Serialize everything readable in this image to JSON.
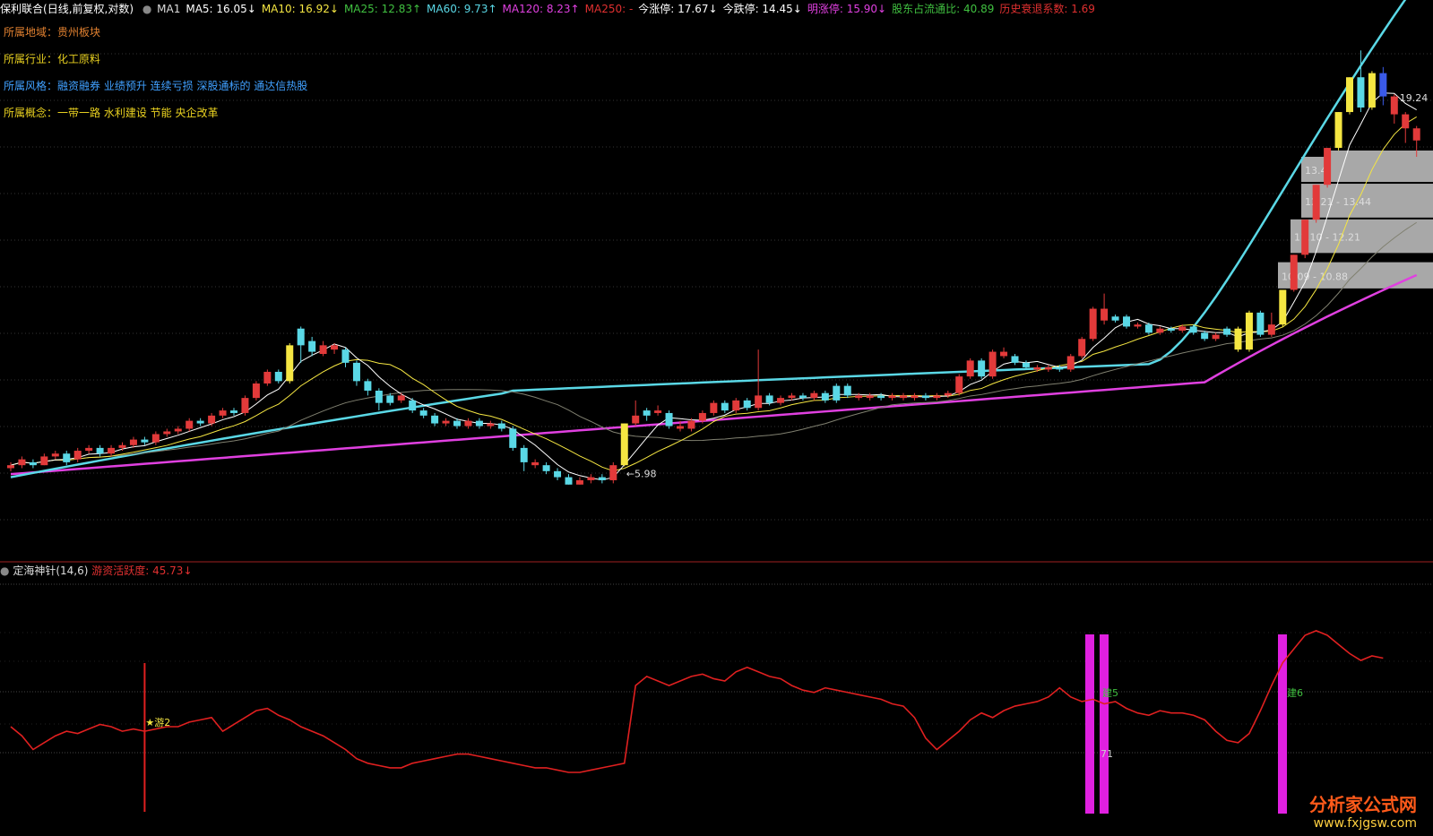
{
  "header": {
    "title": "保利联合",
    "mode": "(日线,前复权,对数)",
    "ma_items": [
      {
        "label": "MA1",
        "color": "#dddddd"
      },
      {
        "label": "MA5: 16.05↓",
        "color": "#ffffff"
      },
      {
        "label": "MA10: 16.92↓",
        "color": "#f5e642"
      },
      {
        "label": "MA25: 12.83↑",
        "color": "#40c040"
      },
      {
        "label": "MA60: 9.73↑",
        "color": "#5ad8e6"
      },
      {
        "label": "MA120: 8.23↑",
        "color": "#e040e0"
      },
      {
        "label": "MA250: -",
        "color": "#e03030"
      },
      {
        "label": "今涨停: 17.67↓",
        "color": "#ffffff"
      },
      {
        "label": "今跌停: 14.45↓",
        "color": "#ffffff"
      },
      {
        "label": "明涨停: 15.90↓",
        "color": "#e040e0"
      },
      {
        "label": "股东占流通比: 40.89",
        "color": "#40c040"
      },
      {
        "label": "历史衰退系数: 1.69",
        "color": "#e03030"
      }
    ]
  },
  "info": {
    "region_label": "所属地域：",
    "region_value": "贵州板块",
    "industry_label": "所属行业：",
    "industry_value": "化工原料",
    "style_label": "所属风格：",
    "style_value": "融资融券 业绩预升 连续亏损 深股通标的 通达信热股",
    "concept_label": "所属概念：",
    "concept_value": "一带一路 水利建设 节能 央企改革"
  },
  "sub_header": {
    "indicator": "定海神针(14,6)",
    "value": "游资活跃度: 45.73↓"
  },
  "watermark": {
    "name": "分析家公式网",
    "url": "www.fxjgsw.com"
  },
  "chart_data": [
    {
      "type": "candlestick",
      "title": "保利联合",
      "y_scale": "log",
      "ylim": [
        5.0,
        21.0
      ],
      "annotations": [
        {
          "text": "←5.98",
          "index": 55
        },
        {
          "text": "19.24",
          "index": 124
        }
      ],
      "volume_profile": [
        {
          "label": "13.44 - 14.45",
          "low": 13.44,
          "high": 14.45
        },
        {
          "label": "12.21 - 13.44",
          "low": 12.21,
          "high": 13.44
        },
        {
          "label": "11.10 - 12.21",
          "low": 11.1,
          "high": 12.21
        },
        {
          "label": "10.09 - 10.88",
          "low": 10.09,
          "high": 10.88
        }
      ],
      "candles": [
        [
          6.25,
          6.3,
          6.2,
          6.35,
          "up"
        ],
        [
          6.3,
          6.4,
          6.25,
          6.45,
          "up"
        ],
        [
          6.35,
          6.3,
          6.25,
          6.4,
          "down"
        ],
        [
          6.3,
          6.45,
          6.3,
          6.5,
          "up"
        ],
        [
          6.45,
          6.5,
          6.4,
          6.55,
          "up"
        ],
        [
          6.5,
          6.35,
          6.3,
          6.55,
          "down"
        ],
        [
          6.4,
          6.55,
          6.35,
          6.6,
          "up"
        ],
        [
          6.55,
          6.6,
          6.5,
          6.65,
          "up"
        ],
        [
          6.6,
          6.5,
          6.45,
          6.65,
          "down"
        ],
        [
          6.5,
          6.6,
          6.45,
          6.65,
          "up"
        ],
        [
          6.6,
          6.65,
          6.55,
          6.7,
          "up"
        ],
        [
          6.65,
          6.75,
          6.6,
          6.8,
          "up"
        ],
        [
          6.75,
          6.7,
          6.65,
          6.8,
          "down"
        ],
        [
          6.7,
          6.85,
          6.65,
          6.9,
          "up"
        ],
        [
          6.85,
          6.9,
          6.8,
          6.95,
          "up"
        ],
        [
          6.9,
          6.95,
          6.85,
          7.0,
          "up"
        ],
        [
          6.95,
          7.1,
          6.9,
          7.15,
          "up"
        ],
        [
          7.1,
          7.05,
          7.0,
          7.15,
          "down"
        ],
        [
          7.05,
          7.2,
          7.0,
          7.25,
          "up"
        ],
        [
          7.2,
          7.3,
          7.15,
          7.35,
          "up"
        ],
        [
          7.3,
          7.25,
          7.2,
          7.35,
          "down"
        ],
        [
          7.25,
          7.55,
          7.2,
          7.6,
          "up"
        ],
        [
          7.55,
          7.85,
          7.5,
          7.9,
          "up"
        ],
        [
          7.85,
          8.1,
          7.8,
          8.15,
          "up"
        ],
        [
          8.1,
          7.9,
          7.85,
          8.15,
          "down"
        ],
        [
          7.9,
          8.7,
          7.85,
          8.75,
          "limit"
        ],
        [
          8.7,
          9.1,
          8.3,
          9.15,
          "down"
        ],
        [
          8.8,
          8.55,
          8.45,
          8.9,
          "down"
        ],
        [
          8.5,
          8.7,
          8.45,
          8.8,
          "up"
        ],
        [
          8.7,
          8.6,
          8.5,
          8.75,
          "up"
        ],
        [
          8.6,
          8.3,
          8.2,
          8.65,
          "down"
        ],
        [
          8.3,
          7.9,
          7.8,
          8.35,
          "down"
        ],
        [
          7.9,
          7.7,
          7.6,
          7.95,
          "down"
        ],
        [
          7.7,
          7.45,
          7.3,
          7.75,
          "down"
        ],
        [
          7.45,
          7.6,
          7.4,
          7.65,
          "down"
        ],
        [
          7.6,
          7.5,
          7.45,
          7.65,
          "up"
        ],
        [
          7.5,
          7.3,
          7.25,
          7.55,
          "down"
        ],
        [
          7.3,
          7.2,
          7.15,
          7.35,
          "down"
        ],
        [
          7.2,
          7.05,
          7.0,
          7.25,
          "down"
        ],
        [
          7.05,
          7.1,
          7.0,
          7.15,
          "up"
        ],
        [
          7.1,
          7.0,
          6.95,
          7.15,
          "down"
        ],
        [
          7.0,
          7.1,
          6.95,
          7.15,
          "up"
        ],
        [
          7.1,
          7.0,
          6.95,
          7.15,
          "down"
        ],
        [
          7.0,
          7.05,
          6.95,
          7.1,
          "up"
        ],
        [
          7.05,
          6.95,
          6.9,
          7.1,
          "down"
        ],
        [
          6.95,
          6.6,
          6.55,
          7.0,
          "down"
        ],
        [
          6.6,
          6.35,
          6.2,
          6.65,
          "down"
        ],
        [
          6.35,
          6.3,
          6.25,
          6.4,
          "up"
        ],
        [
          6.3,
          6.2,
          6.15,
          6.35,
          "down"
        ],
        [
          6.2,
          6.1,
          6.05,
          6.25,
          "down"
        ],
        [
          6.1,
          5.98,
          5.98,
          6.15,
          "down"
        ],
        [
          5.98,
          6.05,
          5.98,
          6.1,
          "up"
        ],
        [
          6.05,
          6.1,
          6.0,
          6.15,
          "up"
        ],
        [
          6.1,
          6.05,
          6.0,
          6.15,
          "down"
        ],
        [
          6.05,
          6.3,
          6.0,
          6.35,
          "up"
        ],
        [
          6.3,
          7.05,
          6.28,
          7.05,
          "limit"
        ],
        [
          7.05,
          7.2,
          7.0,
          7.5,
          "up"
        ],
        [
          7.2,
          7.3,
          7.1,
          7.35,
          "down"
        ],
        [
          7.3,
          7.25,
          7.2,
          7.4,
          "up"
        ],
        [
          7.25,
          7.0,
          6.95,
          7.3,
          "down"
        ],
        [
          7.0,
          6.95,
          6.9,
          7.1,
          "up"
        ],
        [
          6.95,
          7.1,
          6.9,
          7.15,
          "up"
        ],
        [
          7.1,
          7.25,
          7.05,
          7.3,
          "up"
        ],
        [
          7.25,
          7.45,
          7.2,
          7.5,
          "up"
        ],
        [
          7.45,
          7.3,
          7.25,
          7.5,
          "down"
        ],
        [
          7.3,
          7.5,
          7.25,
          7.55,
          "up"
        ],
        [
          7.5,
          7.35,
          7.3,
          7.55,
          "down"
        ],
        [
          7.35,
          7.6,
          7.3,
          8.6,
          "up"
        ],
        [
          7.6,
          7.45,
          7.4,
          7.65,
          "down"
        ],
        [
          7.45,
          7.55,
          7.4,
          7.6,
          "up"
        ],
        [
          7.55,
          7.6,
          7.5,
          7.65,
          "up"
        ],
        [
          7.6,
          7.55,
          7.5,
          7.65,
          "down"
        ],
        [
          7.55,
          7.65,
          7.5,
          7.7,
          "up"
        ],
        [
          7.65,
          7.5,
          7.45,
          7.7,
          "down"
        ],
        [
          7.5,
          7.8,
          7.45,
          7.85,
          "down"
        ],
        [
          7.8,
          7.6,
          7.55,
          7.85,
          "down"
        ],
        [
          7.6,
          7.55,
          7.5,
          7.65,
          "up"
        ],
        [
          7.55,
          7.6,
          7.5,
          7.65,
          "up"
        ],
        [
          7.6,
          7.55,
          7.5,
          7.65,
          "down"
        ],
        [
          7.55,
          7.6,
          7.5,
          7.65,
          "up"
        ],
        [
          7.6,
          7.55,
          7.5,
          7.65,
          "up"
        ],
        [
          7.55,
          7.6,
          7.5,
          7.65,
          "up"
        ],
        [
          7.6,
          7.55,
          7.5,
          7.65,
          "down"
        ],
        [
          7.55,
          7.6,
          7.5,
          7.65,
          "up"
        ],
        [
          7.6,
          7.65,
          7.55,
          7.7,
          "up"
        ],
        [
          7.65,
          8.0,
          7.6,
          8.05,
          "up"
        ],
        [
          8.0,
          8.35,
          7.95,
          8.4,
          "up"
        ],
        [
          8.35,
          8.0,
          7.95,
          8.4,
          "down"
        ],
        [
          8.0,
          8.55,
          7.95,
          8.6,
          "up"
        ],
        [
          8.55,
          8.45,
          8.4,
          8.65,
          "up"
        ],
        [
          8.45,
          8.3,
          8.25,
          8.5,
          "down"
        ],
        [
          8.3,
          8.2,
          8.15,
          8.35,
          "down"
        ],
        [
          8.2,
          8.15,
          8.1,
          8.25,
          "up"
        ],
        [
          8.15,
          8.2,
          8.1,
          8.25,
          "up"
        ],
        [
          8.2,
          8.15,
          8.1,
          8.25,
          "down"
        ],
        [
          8.15,
          8.45,
          8.1,
          8.5,
          "up"
        ],
        [
          8.45,
          8.85,
          8.4,
          8.9,
          "up"
        ],
        [
          8.85,
          9.6,
          8.8,
          9.65,
          "up"
        ],
        [
          9.6,
          9.3,
          9.2,
          10.0,
          "up"
        ],
        [
          9.3,
          9.4,
          9.25,
          9.45,
          "down"
        ],
        [
          9.4,
          9.15,
          9.1,
          9.45,
          "down"
        ],
        [
          9.15,
          9.2,
          9.1,
          9.25,
          "up"
        ],
        [
          9.2,
          9.0,
          8.95,
          9.25,
          "down"
        ],
        [
          9.0,
          9.1,
          8.95,
          9.15,
          "up"
        ],
        [
          9.1,
          9.05,
          9.0,
          9.15,
          "down"
        ],
        [
          9.05,
          9.15,
          9.0,
          9.2,
          "up"
        ],
        [
          9.15,
          9.0,
          8.95,
          9.2,
          "down"
        ],
        [
          9.0,
          8.85,
          8.8,
          9.05,
          "down"
        ],
        [
          8.85,
          8.95,
          8.8,
          9.0,
          "up"
        ],
        [
          8.95,
          9.1,
          8.9,
          9.15,
          "down"
        ],
        [
          9.1,
          8.6,
          8.55,
          9.15,
          "limit"
        ],
        [
          8.6,
          9.5,
          8.55,
          9.55,
          "limit"
        ],
        [
          9.5,
          8.95,
          8.9,
          9.55,
          "down"
        ],
        [
          8.95,
          9.2,
          8.9,
          9.5,
          "up"
        ],
        [
          9.2,
          10.1,
          9.15,
          10.1,
          "limit"
        ],
        [
          10.1,
          11.1,
          10.05,
          11.1,
          "up"
        ],
        [
          11.1,
          12.2,
          11.0,
          12.2,
          "up"
        ],
        [
          12.2,
          13.4,
          12.1,
          13.4,
          "up"
        ],
        [
          13.4,
          14.8,
          13.3,
          14.8,
          "up"
        ],
        [
          14.8,
          16.3,
          14.7,
          16.3,
          "limit"
        ],
        [
          16.3,
          17.9,
          16.2,
          17.9,
          "limit"
        ],
        [
          17.9,
          16.5,
          16.3,
          19.24,
          "down"
        ],
        [
          16.5,
          18.1,
          16.4,
          18.2,
          "limit"
        ],
        [
          18.1,
          17.0,
          16.6,
          18.4,
          "blue"
        ],
        [
          17.0,
          16.2,
          15.8,
          17.1,
          "up"
        ],
        [
          16.2,
          15.6,
          15.0,
          16.3,
          "up"
        ],
        [
          15.6,
          15.1,
          14.45,
          15.7,
          "up"
        ]
      ]
    },
    {
      "type": "line",
      "title": "定海神针(14,6)",
      "series": [
        {
          "name": "游资活跃度",
          "color": "#e02020",
          "values": [
            40,
            36,
            30,
            33,
            36,
            38,
            37,
            39,
            41,
            40,
            38,
            39,
            38,
            39,
            40,
            40,
            42,
            43,
            44,
            38,
            41,
            44,
            47,
            48,
            45,
            43,
            40,
            38,
            36,
            33,
            30,
            26,
            24,
            23,
            22,
            22,
            24,
            25,
            26,
            27,
            28,
            28,
            27,
            26,
            25,
            24,
            23,
            22,
            22,
            21,
            20,
            20,
            21,
            22,
            23,
            24,
            58,
            62,
            60,
            58,
            60,
            62,
            63,
            61,
            60,
            64,
            66,
            64,
            62,
            61,
            58,
            56,
            55,
            57,
            56,
            55,
            54,
            53,
            52,
            50,
            49,
            44,
            35,
            30,
            34,
            38,
            43,
            46,
            44,
            47,
            49,
            50,
            51,
            53,
            57,
            53,
            51,
            52,
            50,
            51,
            48,
            46,
            45,
            47,
            46,
            46,
            45,
            43,
            38,
            34,
            33,
            37,
            47,
            58,
            68,
            74,
            80,
            82,
            80,
            76,
            72,
            69,
            71,
            70
          ]
        }
      ],
      "markers": [
        {
          "text": "★游2",
          "index": 12
        },
        {
          "text": "建5",
          "index": 99
        },
        {
          "text": "71",
          "index": 99
        },
        {
          "text": "建6",
          "index": 116
        }
      ],
      "ylim": [
        0,
        100
      ]
    }
  ]
}
